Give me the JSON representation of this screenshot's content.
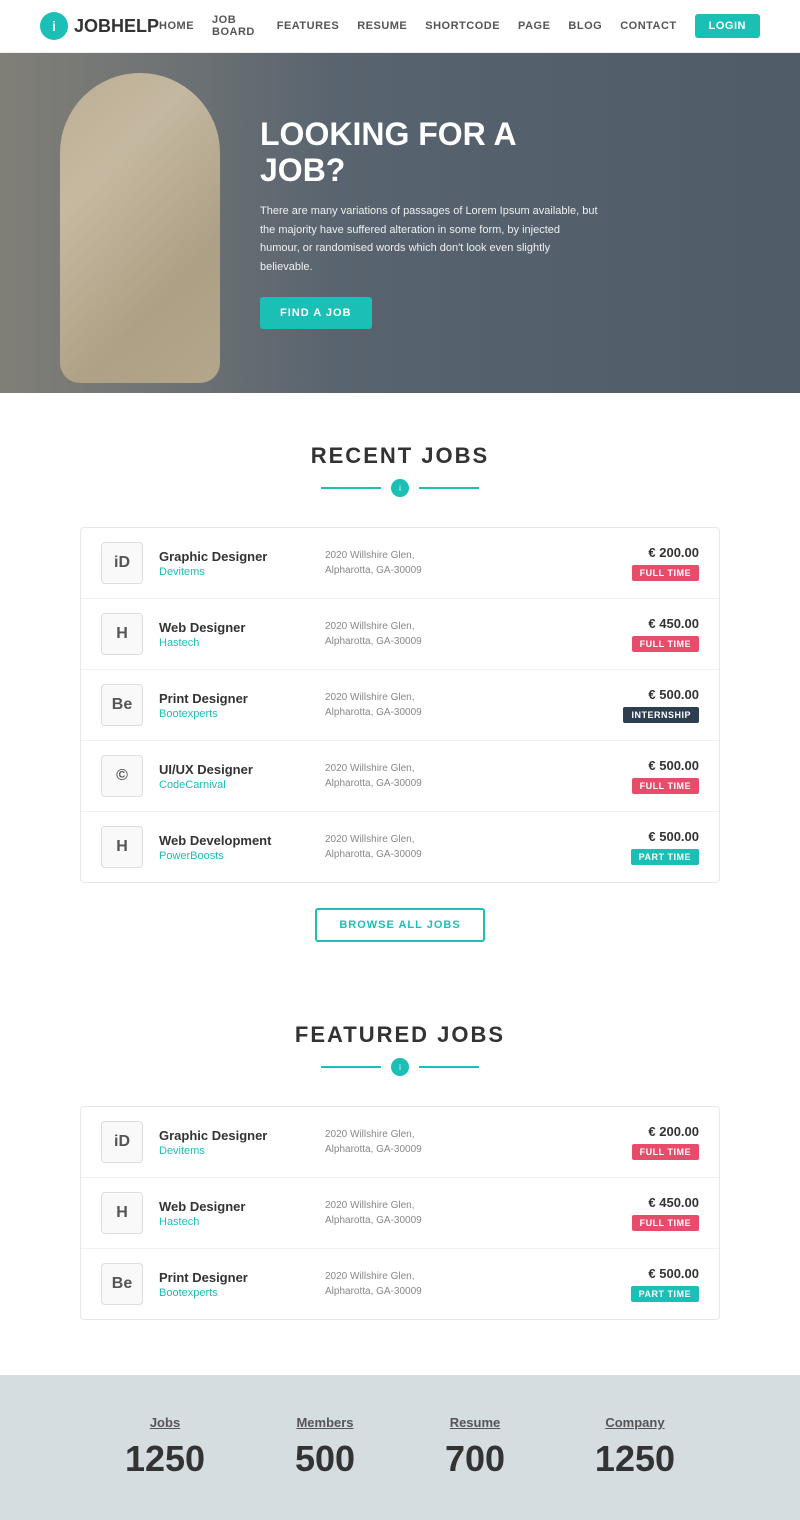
{
  "navbar": {
    "logo_text_normal": "JOB",
    "logo_text_bold": "HELP",
    "links": [
      "HOME",
      "JOB BOARD",
      "FEATURES",
      "RESUME",
      "SHORTCODE",
      "PAGE",
      "BLOG",
      "CONTACT"
    ],
    "login_label": "LOGIN"
  },
  "hero": {
    "title": "LOOKING FOR A JOB?",
    "description": "There are many variations of passages of Lorem Ipsum available, but the majority have suffered alteration in some form, by injected humour, or randomised words which don't look even slightly believable.",
    "cta_label": "FIND A JOB"
  },
  "recent_jobs": {
    "section_title": "RECENT JOBS",
    "jobs": [
      {
        "logo": "iD",
        "title": "Graphic Designer",
        "company": "Devitems",
        "location": "2020 Willshire Glen,\nAlpharotta, GA-30009",
        "salary": "€ 200.00",
        "badge": "FULL TIME",
        "badge_type": "fulltime"
      },
      {
        "logo": "H",
        "title": "Web Designer",
        "company": "Hastech",
        "location": "2020 Willshire Glen,\nAlpharotta, GA-30009",
        "salary": "€ 450.00",
        "badge": "FULL TIME",
        "badge_type": "fulltime"
      },
      {
        "logo": "Be",
        "title": "Print Designer",
        "company": "Bootexperts",
        "location": "2020 Willshire Glen,\nAlpharotta, GA-30009",
        "salary": "€ 500.00",
        "badge": "INTERNSHIP",
        "badge_type": "internship"
      },
      {
        "logo": "©",
        "title": "UI/UX Designer",
        "company": "CodeCarnival",
        "location": "2020 Willshire Glen,\nAlpharotta, GA-30009",
        "salary": "€ 500.00",
        "badge": "FULL TIME",
        "badge_type": "fulltime"
      },
      {
        "logo": "H",
        "title": "Web Development",
        "company": "PowerBoosts",
        "location": "2020 Willshire Glen,\nAlpharotta, GA-30009",
        "salary": "€ 500.00",
        "badge": "PART TIME",
        "badge_type": "parttime"
      }
    ],
    "browse_label": "BROWSE ALL JOBS"
  },
  "featured_jobs": {
    "section_title": "FEATURED JOBS",
    "jobs": [
      {
        "logo": "iD",
        "title": "Graphic Designer",
        "company": "Devitems",
        "location": "2020 Willshire Glen,\nAlpharotta, GA-30009",
        "salary": "€ 200.00",
        "badge": "FULL TIME",
        "badge_type": "fulltime"
      },
      {
        "logo": "H",
        "title": "Web Designer",
        "company": "Hastech",
        "location": "2020 Willshire Glen,\nAlpharotta, GA-30009",
        "salary": "€ 450.00",
        "badge": "FULL TIME",
        "badge_type": "fulltime"
      },
      {
        "logo": "Be",
        "title": "Print Designer",
        "company": "Bootexperts",
        "location": "2020 Willshire Glen,\nAlpharotta, GA-30009",
        "salary": "€ 500.00",
        "badge": "PART TIME",
        "badge_type": "parttime"
      }
    ]
  },
  "stats": [
    {
      "label": "Jobs",
      "value": "1250"
    },
    {
      "label": "Members",
      "value": "500"
    },
    {
      "label": "Resume",
      "value": "700"
    },
    {
      "label": "Company",
      "value": "1250"
    }
  ]
}
